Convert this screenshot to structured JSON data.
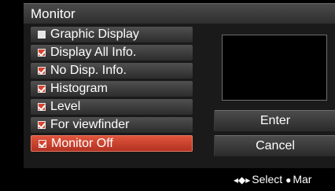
{
  "title": "Monitor",
  "menu": {
    "items": [
      {
        "label": "Graphic Display",
        "checked": false,
        "selected": false
      },
      {
        "label": "Display All Info.",
        "checked": true,
        "selected": false
      },
      {
        "label": "No Disp. Info.",
        "checked": true,
        "selected": false
      },
      {
        "label": "Histogram",
        "checked": true,
        "selected": false
      },
      {
        "label": "Level",
        "checked": true,
        "selected": false
      },
      {
        "label": "For viewfinder",
        "checked": true,
        "selected": false
      },
      {
        "label": "Monitor Off",
        "checked": true,
        "selected": true
      }
    ]
  },
  "buttons": {
    "enter": "Enter",
    "cancel": "Cancel"
  },
  "footer": {
    "select_icon": "◂◆▸",
    "select_label": "Select",
    "ok_icon": "●",
    "ok_label": "Mar"
  },
  "colors": {
    "selected": "#c83a26",
    "checkbox_mark": "#d84530"
  }
}
